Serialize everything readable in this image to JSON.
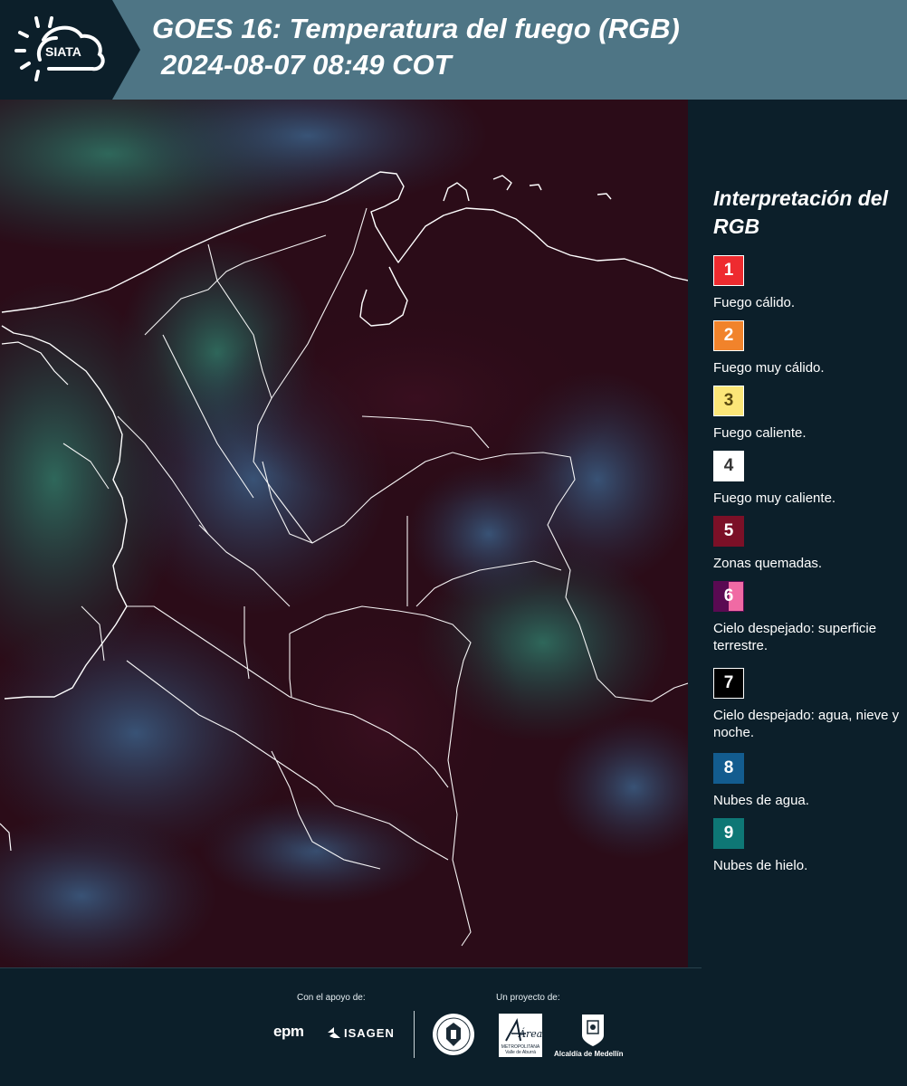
{
  "header": {
    "logo_text": "SIATA",
    "title_line1": "GOES 16: Temperatura del fuego (RGB)",
    "title_line2": "2024-08-07 08:49 COT"
  },
  "legend": {
    "title": "Interpretación del RGB",
    "items": [
      {
        "number": "1",
        "label": "Fuego cálido.",
        "color": "#ee2b2f"
      },
      {
        "number": "2",
        "label": "Fuego muy cálido.",
        "color": "#f1832b"
      },
      {
        "number": "3",
        "label": "Fuego caliente.",
        "color": "#fbe678"
      },
      {
        "number": "4",
        "label": "Fuego muy caliente.",
        "color": "#ffffff"
      },
      {
        "number": "5",
        "label": "Zonas quemadas.",
        "color": "#7b1027"
      },
      {
        "number": "6",
        "label": "Cielo despejado: superficie terrestre.",
        "color_left": "#5a0a52",
        "color_right": "#f06aa4"
      },
      {
        "number": "7",
        "label": "Cielo despejado: agua, nieve y noche.",
        "color": "#000000"
      },
      {
        "number": "8",
        "label": "Nubes de agua.",
        "color": "#135c8f"
      },
      {
        "number": "9",
        "label": "Nubes de hielo.",
        "color": "#0e7775"
      }
    ]
  },
  "footer": {
    "support_label": "Con el apoyo de:",
    "project_label": "Un proyecto de:",
    "sponsor_1": "epm",
    "sponsor_2": "ISAGEN",
    "partner_area": "Área",
    "partner_area_sub": "METROPOLITANA Valle de Aburrá",
    "partner_alcaldia": "Alcaldía de Medellín"
  }
}
